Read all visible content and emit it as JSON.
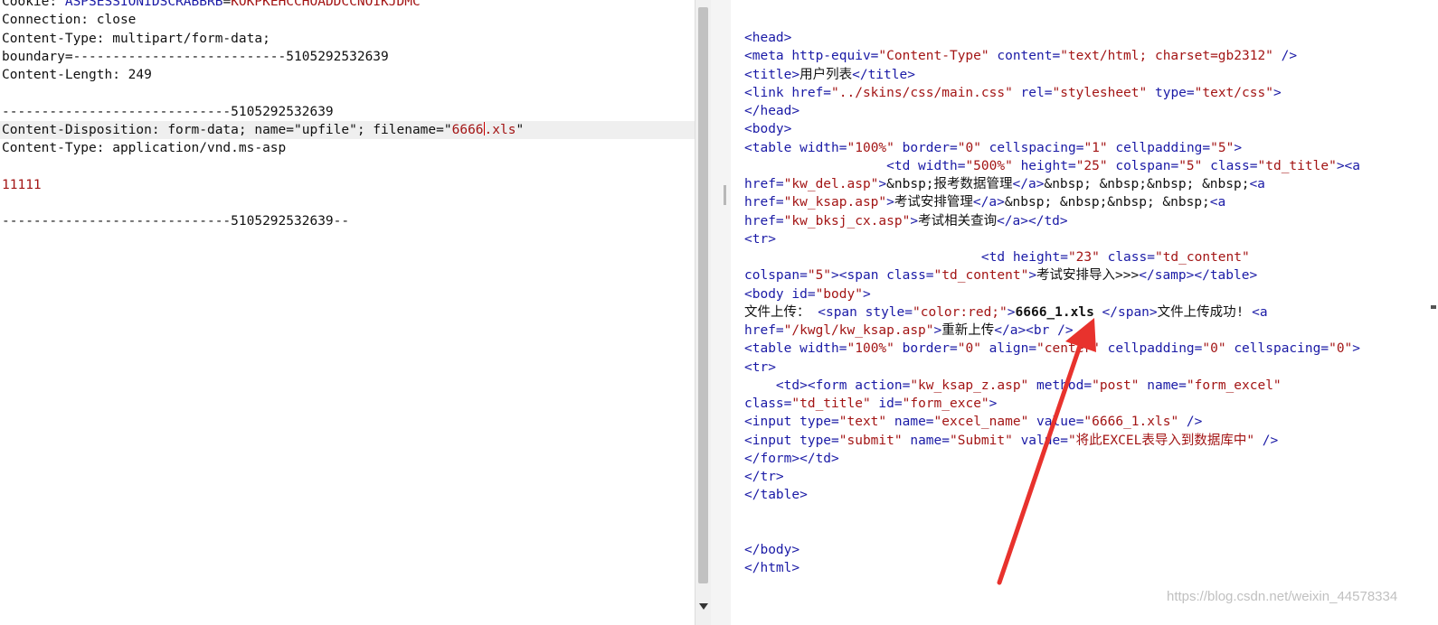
{
  "request": {
    "lines": [
      {
        "parts": [
          {
            "c": "t",
            "x": "Cookie: "
          },
          {
            "c": "k",
            "x": "ASPSESSIONIDSCRABBRB"
          },
          {
            "c": "t",
            "x": "="
          },
          {
            "c": "v",
            "x": "KOKPKEHCCHOADDCCNOIKJDMC"
          }
        ]
      },
      {
        "parts": [
          {
            "c": "t",
            "x": "Connection: close"
          }
        ]
      },
      {
        "parts": [
          {
            "c": "t",
            "x": "Content-Type: multipart/form-data;"
          }
        ]
      },
      {
        "parts": [
          {
            "c": "t",
            "x": "boundary=---------------------------5105292532639"
          }
        ]
      },
      {
        "parts": [
          {
            "c": "t",
            "x": "Content-Length: 249"
          }
        ]
      },
      {
        "parts": []
      },
      {
        "parts": [
          {
            "c": "t",
            "x": "-----------------------------5105292532639"
          }
        ]
      },
      {
        "hl": true,
        "parts": [
          {
            "c": "t",
            "x": "Content-Disposition: form-data; name=\"upfile\"; filename=\""
          },
          {
            "c": "v",
            "x": "6666"
          },
          {
            "c": "caret",
            "x": ""
          },
          {
            "c": "v",
            "x": ".xls"
          },
          {
            "c": "t",
            "x": "\""
          }
        ]
      },
      {
        "parts": [
          {
            "c": "t",
            "x": "Content-Type: application/vnd.ms-asp"
          }
        ]
      },
      {
        "parts": []
      },
      {
        "parts": [
          {
            "c": "v",
            "x": "11111"
          }
        ]
      },
      {
        "parts": []
      },
      {
        "parts": [
          {
            "c": "t",
            "x": "-----------------------------5105292532639--"
          }
        ]
      }
    ]
  },
  "response": {
    "lines": [
      {
        "parts": [
          {
            "c": "k",
            "x": "<head>"
          }
        ]
      },
      {
        "parts": [
          {
            "c": "k",
            "x": "<meta http-equiv="
          },
          {
            "c": "v",
            "x": "\"Content-Type\""
          },
          {
            "c": "k",
            "x": " content="
          },
          {
            "c": "v",
            "x": "\"text/html; charset=gb2312\""
          },
          {
            "c": "k",
            "x": " />"
          }
        ]
      },
      {
        "parts": [
          {
            "c": "k",
            "x": "<title>"
          },
          {
            "c": "t",
            "x": "用户列表"
          },
          {
            "c": "k",
            "x": "</title>"
          }
        ]
      },
      {
        "parts": [
          {
            "c": "k",
            "x": "<link href="
          },
          {
            "c": "v",
            "x": "\"../skins/css/main.css\""
          },
          {
            "c": "k",
            "x": " rel="
          },
          {
            "c": "v",
            "x": "\"stylesheet\""
          },
          {
            "c": "k",
            "x": " type="
          },
          {
            "c": "v",
            "x": "\"text/css\""
          },
          {
            "c": "k",
            "x": ">"
          }
        ]
      },
      {
        "parts": [
          {
            "c": "k",
            "x": "</head>"
          }
        ]
      },
      {
        "parts": [
          {
            "c": "k",
            "x": "<body>"
          }
        ]
      },
      {
        "parts": [
          {
            "c": "k",
            "x": "<table width="
          },
          {
            "c": "v",
            "x": "\"100%\""
          },
          {
            "c": "k",
            "x": " border="
          },
          {
            "c": "v",
            "x": "\"0\""
          },
          {
            "c": "k",
            "x": " cellspacing="
          },
          {
            "c": "v",
            "x": "\"1\""
          },
          {
            "c": "k",
            "x": " cellpadding="
          },
          {
            "c": "v",
            "x": "\"5\""
          },
          {
            "c": "k",
            "x": ">"
          }
        ]
      },
      {
        "parts": [
          {
            "c": "t",
            "x": "                  "
          },
          {
            "c": "k",
            "x": "<td width="
          },
          {
            "c": "v",
            "x": "\"500%\""
          },
          {
            "c": "k",
            "x": " height="
          },
          {
            "c": "v",
            "x": "\"25\""
          },
          {
            "c": "k",
            "x": " colspan="
          },
          {
            "c": "v",
            "x": "\"5\""
          },
          {
            "c": "k",
            "x": " class="
          },
          {
            "c": "v",
            "x": "\"td_title\""
          },
          {
            "c": "k",
            "x": "><a"
          }
        ]
      },
      {
        "parts": [
          {
            "c": "k",
            "x": "href="
          },
          {
            "c": "v",
            "x": "\"kw_del.asp\""
          },
          {
            "c": "k",
            "x": ">"
          },
          {
            "c": "t",
            "x": "&nbsp;报考数据管理"
          },
          {
            "c": "k",
            "x": "</a>"
          },
          {
            "c": "t",
            "x": "&nbsp; &nbsp;&nbsp; &nbsp;"
          },
          {
            "c": "k",
            "x": "<a"
          }
        ]
      },
      {
        "parts": [
          {
            "c": "k",
            "x": "href="
          },
          {
            "c": "v",
            "x": "\"kw_ksap.asp\""
          },
          {
            "c": "k",
            "x": ">"
          },
          {
            "c": "t",
            "x": "考试安排管理"
          },
          {
            "c": "k",
            "x": "</a>"
          },
          {
            "c": "t",
            "x": "&nbsp; &nbsp;&nbsp; &nbsp;"
          },
          {
            "c": "k",
            "x": "<a"
          }
        ]
      },
      {
        "parts": [
          {
            "c": "k",
            "x": "href="
          },
          {
            "c": "v",
            "x": "\"kw_bksj_cx.asp\""
          },
          {
            "c": "k",
            "x": ">"
          },
          {
            "c": "t",
            "x": "考试相关查询"
          },
          {
            "c": "k",
            "x": "</a></td>"
          }
        ]
      },
      {
        "parts": [
          {
            "c": "k",
            "x": "<tr>"
          }
        ]
      },
      {
        "parts": [
          {
            "c": "t",
            "x": "                              "
          },
          {
            "c": "k",
            "x": "<td height="
          },
          {
            "c": "v",
            "x": "\"23\""
          },
          {
            "c": "k",
            "x": " class="
          },
          {
            "c": "v",
            "x": "\"td_content\""
          }
        ]
      },
      {
        "parts": [
          {
            "c": "k",
            "x": "colspan="
          },
          {
            "c": "v",
            "x": "\"5\""
          },
          {
            "c": "k",
            "x": "><span class="
          },
          {
            "c": "v",
            "x": "\"td_content\""
          },
          {
            "c": "k",
            "x": ">"
          },
          {
            "c": "t",
            "x": "考试安排导入>>>"
          },
          {
            "c": "k",
            "x": "</samp></table>"
          }
        ]
      },
      {
        "parts": [
          {
            "c": "k",
            "x": "<body id="
          },
          {
            "c": "v",
            "x": "\"body\""
          },
          {
            "c": "k",
            "x": ">"
          }
        ]
      },
      {
        "parts": [
          {
            "c": "t",
            "x": "文件上传： "
          },
          {
            "c": "k",
            "x": "<span style="
          },
          {
            "c": "v",
            "x": "\"color:red;\""
          },
          {
            "c": "k",
            "x": ">"
          },
          {
            "c": "b",
            "x": "6666_1.xls "
          },
          {
            "c": "k",
            "x": "</span>"
          },
          {
            "c": "t",
            "x": "文件上传成功! "
          },
          {
            "c": "k",
            "x": "<a"
          }
        ]
      },
      {
        "parts": [
          {
            "c": "k",
            "x": "href="
          },
          {
            "c": "v",
            "x": "\"/kwgl/kw_ksap.asp\""
          },
          {
            "c": "k",
            "x": ">"
          },
          {
            "c": "t",
            "x": "重新上传"
          },
          {
            "c": "k",
            "x": "</a><br />"
          }
        ]
      },
      {
        "parts": [
          {
            "c": "k",
            "x": "<table width="
          },
          {
            "c": "v",
            "x": "\"100%\""
          },
          {
            "c": "k",
            "x": " border="
          },
          {
            "c": "v",
            "x": "\"0\""
          },
          {
            "c": "k",
            "x": " align="
          },
          {
            "c": "v",
            "x": "\"center\""
          },
          {
            "c": "k",
            "x": " cellpadding="
          },
          {
            "c": "v",
            "x": "\"0\""
          },
          {
            "c": "k",
            "x": " cellspacing="
          },
          {
            "c": "v",
            "x": "\"0\""
          },
          {
            "c": "k",
            "x": ">"
          }
        ]
      },
      {
        "parts": [
          {
            "c": "k",
            "x": "<tr>"
          }
        ]
      },
      {
        "parts": [
          {
            "c": "t",
            "x": "    "
          },
          {
            "c": "k",
            "x": "<td><form action="
          },
          {
            "c": "v",
            "x": "\"kw_ksap_z.asp\""
          },
          {
            "c": "k",
            "x": " method="
          },
          {
            "c": "v",
            "x": "\"post\""
          },
          {
            "c": "k",
            "x": " name="
          },
          {
            "c": "v",
            "x": "\"form_excel\""
          }
        ]
      },
      {
        "parts": [
          {
            "c": "k",
            "x": "class="
          },
          {
            "c": "v",
            "x": "\"td_title\""
          },
          {
            "c": "k",
            "x": " id="
          },
          {
            "c": "v",
            "x": "\"form_exce\""
          },
          {
            "c": "k",
            "x": ">"
          }
        ]
      },
      {
        "parts": [
          {
            "c": "k",
            "x": "<input type="
          },
          {
            "c": "v",
            "x": "\"text\""
          },
          {
            "c": "k",
            "x": " name="
          },
          {
            "c": "v",
            "x": "\"excel_name\""
          },
          {
            "c": "k",
            "x": " value="
          },
          {
            "c": "v",
            "x": "\"6666_1.xls\""
          },
          {
            "c": "k",
            "x": " />"
          }
        ]
      },
      {
        "parts": [
          {
            "c": "k",
            "x": "<input type="
          },
          {
            "c": "v",
            "x": "\"submit\""
          },
          {
            "c": "k",
            "x": " name="
          },
          {
            "c": "v",
            "x": "\"Submit\""
          },
          {
            "c": "k",
            "x": " value="
          },
          {
            "c": "v",
            "x": "\"将此EXCEL表导入到数据库中\""
          },
          {
            "c": "k",
            "x": " />"
          }
        ]
      },
      {
        "parts": [
          {
            "c": "k",
            "x": "</form></td>"
          }
        ]
      },
      {
        "parts": [
          {
            "c": "k",
            "x": "</tr>"
          }
        ]
      },
      {
        "parts": [
          {
            "c": "k",
            "x": "</table>"
          }
        ]
      },
      {
        "parts": []
      },
      {
        "parts": []
      },
      {
        "parts": [
          {
            "c": "k",
            "x": "</body>"
          }
        ]
      },
      {
        "parts": [
          {
            "c": "k",
            "x": "</html>"
          }
        ]
      }
    ]
  },
  "watermark": "https://blog.csdn.net/weixin_44578334",
  "colors": {
    "tag": "#1a1aa6",
    "value": "#a31515",
    "text": "#111111",
    "annotation_arrow": "#e8322d",
    "highlight_line": "#efefef"
  },
  "icons": {
    "annotation": "red-arrow-icon",
    "scroll_down": "scroll-down-arrow-icon"
  }
}
